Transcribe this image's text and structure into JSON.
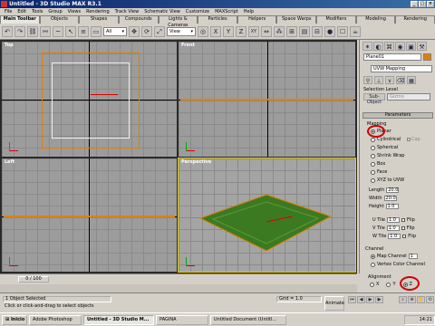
{
  "window": {
    "title": "Untitled - 3D Studio MAX R3.1"
  },
  "menu": [
    "File",
    "Edit",
    "Tools",
    "Group",
    "Views",
    "Rendering",
    "Track View",
    "Schematic View",
    "Customize",
    "MAXScript",
    "Help"
  ],
  "tabs": [
    "Main Toolbar",
    "Objects",
    "Shapes",
    "Compounds",
    "Lights & Cameras",
    "Particles",
    "Helpers",
    "Space Warps",
    "Modifiers",
    "Modeling",
    "Rendering"
  ],
  "toolbar": {
    "selection_filter": "All",
    "coord_system": "View",
    "xy_label": "XY"
  },
  "viewports": {
    "top": "Top",
    "front": "Front",
    "left": "Left",
    "perspective": "Perspective"
  },
  "panel": {
    "object_name": "Plane01",
    "modifier": "UVW Mapping",
    "selection_level_label": "Selection Level",
    "sub_object_label": "Sub-Object",
    "sub_object_value": "Gizmo",
    "parameters_label": "Parameters",
    "mapping_label": "Mapping",
    "mapping_options": [
      "Planar",
      "Cylindrical",
      "Spherical",
      "Shrink Wrap",
      "Box",
      "Face",
      "XYZ to UVW"
    ],
    "cap_label": "Cap",
    "length_label": "Length",
    "length_value": "20.0",
    "width_label": "Width",
    "width_value": "20.0",
    "height_label": "Height",
    "height_value": "1.0",
    "utile_label": "U Tile",
    "utile_value": "1.0",
    "vtile_label": "V Tile",
    "vtile_value": "1.0",
    "wtile_label": "W Tile",
    "wtile_value": "1.0",
    "flip_label": "Flip",
    "channel_label": "Channel",
    "map_channel_label": "Map Channel",
    "map_channel_value": "1",
    "vertex_color_label": "Vertex Color Channel",
    "alignment_label": "Alignment",
    "alignment_options": [
      "X",
      "Y",
      "Z"
    ]
  },
  "timeline": {
    "frame": "0 / 100"
  },
  "status": {
    "objects": "1 Object Selected",
    "hint": "Click or click-and-drag to select objects",
    "grid": "Grid = 1.0",
    "animate": "Animate"
  },
  "taskbar": {
    "start": "Inicio",
    "tasks": [
      "Adobe Photoshop",
      "Untitled - 3D Studio M...",
      "PAGINA",
      "Untitled Document (Untitl..."
    ],
    "clock": "14:21"
  }
}
